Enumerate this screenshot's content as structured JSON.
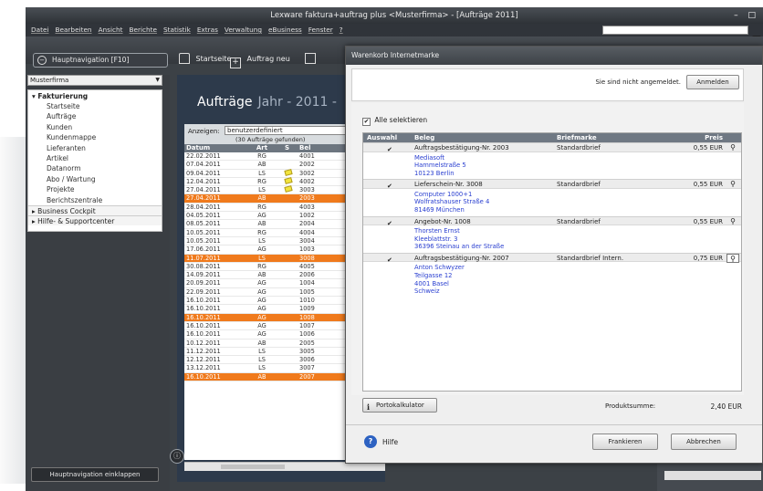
{
  "window": {
    "title": "Lexware faktura+auftrag plus <Musterfirma> - [Aufträge 2011]",
    "controls": "– □"
  },
  "menu": [
    "Datei",
    "Bearbeiten",
    "Ansicht",
    "Berichte",
    "Statistik",
    "Extras",
    "Verwaltung",
    "eBusiness",
    "Fenster",
    "?"
  ],
  "toolbar": {
    "nav_toggle": "Hauptnavigation [F10]",
    "startseite": "Startseite",
    "auftrag_neu": "Auftrag neu"
  },
  "sidebar": {
    "mandant": "Musterfirma",
    "section": "Fakturierung",
    "items": [
      "Startseite",
      "Aufträge",
      "Kunden",
      "Kundenmappe",
      "Lieferanten",
      "Artikel",
      "Datanorm",
      "Abo / Wartung",
      "Projekte",
      "Berichtszentrale"
    ],
    "groups": [
      "Business Cockpit",
      "Hilfe- & Supportcenter"
    ],
    "collapse": "Hauptnavigation einklappen"
  },
  "main": {
    "title": "Aufträge",
    "year": "Jahr - 2011 -",
    "filter_label": "Anzeigen:",
    "filter_value": "benutzerdefiniert",
    "found": "(30 Aufträge gefunden)",
    "columns": [
      "Datum",
      "Art",
      "S",
      "Bel"
    ],
    "rows": [
      {
        "date": "22.02.2011",
        "art": "RG",
        "s": "",
        "nr": "4001",
        "hl": false
      },
      {
        "date": "07.04.2011",
        "art": "AB",
        "s": "",
        "nr": "2002",
        "hl": false
      },
      {
        "date": "09.04.2011",
        "art": "LS",
        "s": "note",
        "nr": "3002",
        "hl": false
      },
      {
        "date": "12.04.2011",
        "art": "RG",
        "s": "note",
        "nr": "4002",
        "hl": false
      },
      {
        "date": "27.04.2011",
        "art": "LS",
        "s": "note",
        "nr": "3003",
        "hl": false
      },
      {
        "date": "27.04.2011",
        "art": "AB",
        "s": "",
        "nr": "2003",
        "hl": true
      },
      {
        "date": "28.04.2011",
        "art": "RG",
        "s": "",
        "nr": "4003",
        "hl": false
      },
      {
        "date": "04.05.2011",
        "art": "AG",
        "s": "",
        "nr": "1002",
        "hl": false
      },
      {
        "date": "08.05.2011",
        "art": "AB",
        "s": "",
        "nr": "2004",
        "hl": false
      },
      {
        "date": "10.05.2011",
        "art": "RG",
        "s": "",
        "nr": "4004",
        "hl": false
      },
      {
        "date": "10.05.2011",
        "art": "LS",
        "s": "",
        "nr": "3004",
        "hl": false
      },
      {
        "date": "17.06.2011",
        "art": "AG",
        "s": "",
        "nr": "1003",
        "hl": false
      },
      {
        "date": "11.07.2011",
        "art": "LS",
        "s": "",
        "nr": "3008",
        "hl": true
      },
      {
        "date": "30.08.2011",
        "art": "RG",
        "s": "",
        "nr": "4005",
        "hl": false
      },
      {
        "date": "14.09.2011",
        "art": "AB",
        "s": "",
        "nr": "2006",
        "hl": false
      },
      {
        "date": "20.09.2011",
        "art": "AG",
        "s": "",
        "nr": "1004",
        "hl": false
      },
      {
        "date": "22.09.2011",
        "art": "AG",
        "s": "",
        "nr": "1005",
        "hl": false
      },
      {
        "date": "16.10.2011",
        "art": "AG",
        "s": "",
        "nr": "1010",
        "hl": false
      },
      {
        "date": "16.10.2011",
        "art": "AG",
        "s": "",
        "nr": "1009",
        "hl": false
      },
      {
        "date": "16.10.2011",
        "art": "AG",
        "s": "",
        "nr": "1008",
        "hl": true
      },
      {
        "date": "16.10.2011",
        "art": "AG",
        "s": "",
        "nr": "1007",
        "hl": false
      },
      {
        "date": "16.10.2011",
        "art": "AG",
        "s": "",
        "nr": "1006",
        "hl": false
      },
      {
        "date": "10.12.2011",
        "art": "AB",
        "s": "",
        "nr": "2005",
        "hl": false
      },
      {
        "date": "11.12.2011",
        "art": "LS",
        "s": "",
        "nr": "3005",
        "hl": false
      },
      {
        "date": "12.12.2011",
        "art": "LS",
        "s": "",
        "nr": "3006",
        "hl": false
      },
      {
        "date": "13.12.2011",
        "art": "LS",
        "s": "",
        "nr": "3007",
        "hl": false
      },
      {
        "date": "16.10.2011",
        "art": "AB",
        "s": "",
        "nr": "2007",
        "hl": true
      }
    ]
  },
  "dialog": {
    "title": "Warenkorb Internetmarke",
    "login_status": "Sie sind nicht angemeldet.",
    "login_button": "Anmelden",
    "select_all": "Alle selektieren",
    "columns": {
      "auswahl": "Auswahl",
      "beleg": "Beleg",
      "marke": "Briefmarke",
      "preis": "Preis"
    },
    "items": [
      {
        "beleg": "Auftragsbestätigung-Nr. 2003",
        "marke": "Standardbrief",
        "preis": "0,55 EUR",
        "address": [
          "Mediasoft",
          "Hammelstraße 5",
          "10123 Berlin"
        ]
      },
      {
        "beleg": "Lieferschein-Nr. 3008",
        "marke": "Standardbrief",
        "preis": "0,55 EUR",
        "address": [
          "Computer 1000+1",
          "Wolfratshauser Straße 4",
          "81469 München"
        ]
      },
      {
        "beleg": "Angebot-Nr. 1008",
        "marke": "Standardbrief",
        "preis": "0,55 EUR",
        "address": [
          "Thorsten Ernst",
          "Kleeblattstr. 3",
          "36396 Steinau an der Straße"
        ]
      },
      {
        "beleg": "Auftragsbestätigung-Nr. 2007",
        "marke": "Standardbrief Intern.",
        "preis": "0,75 EUR",
        "address": [
          "Anton Schwyzer",
          "Teilgasse 12",
          "4001 Basel",
          "Schweiz"
        ]
      }
    ],
    "porto_button": "Portokalkulator",
    "sum_label": "Produktsumme:",
    "sum_value": "2,40 EUR",
    "help": "Hilfe",
    "frankieren": "Frankieren",
    "abbrechen": "Abbrechen"
  }
}
